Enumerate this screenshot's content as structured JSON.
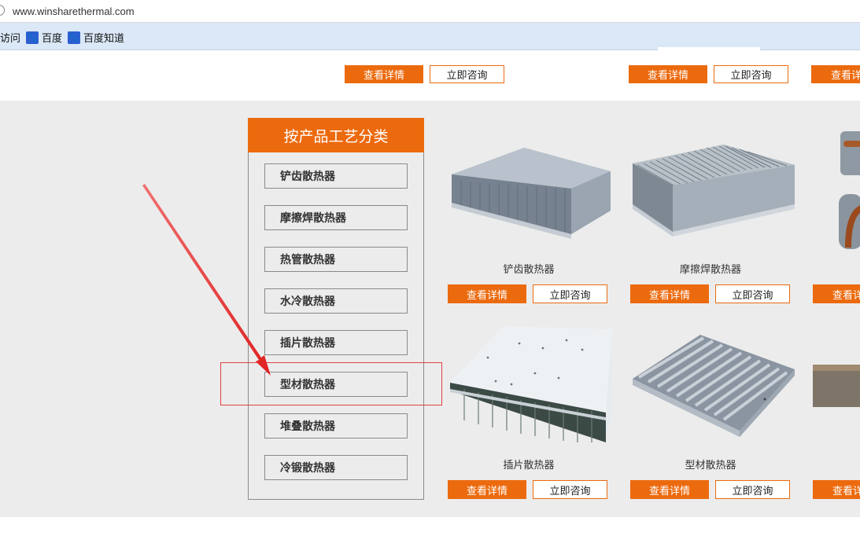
{
  "browser": {
    "url": "www.winsharethermal.com",
    "bookmarks": [
      {
        "label": "访问"
      },
      {
        "label": "百度",
        "icon": "baidu-paw-icon"
      },
      {
        "label": "百度知道",
        "icon": "baidu-paw-icon"
      }
    ]
  },
  "top_row": {
    "detail_label": "查看详情",
    "consult_label": "立即咨询",
    "partial_detail_label": "查看详"
  },
  "sidebar": {
    "title": "按产品工艺分类",
    "items": [
      {
        "label": "铲齿散热器"
      },
      {
        "label": "摩擦焊散热器"
      },
      {
        "label": "热管散热器"
      },
      {
        "label": "水冷散热器"
      },
      {
        "label": "插片散热器"
      },
      {
        "label": "型材散热器"
      },
      {
        "label": "堆叠散热器"
      },
      {
        "label": "冷锻散热器"
      }
    ]
  },
  "products": [
    {
      "name": "铲齿散热器"
    },
    {
      "name": "摩擦焊散热器"
    },
    {
      "name": "插片散热器"
    },
    {
      "name": "型材散热器"
    }
  ],
  "product_buttons": {
    "detail_label": "查看详情",
    "consult_label": "立即咨询",
    "partial_detail_label": "查看详"
  },
  "colors": {
    "accent": "#ec6a0e",
    "highlight_box": "#e44040",
    "annotation_arrow": "#e83030"
  }
}
